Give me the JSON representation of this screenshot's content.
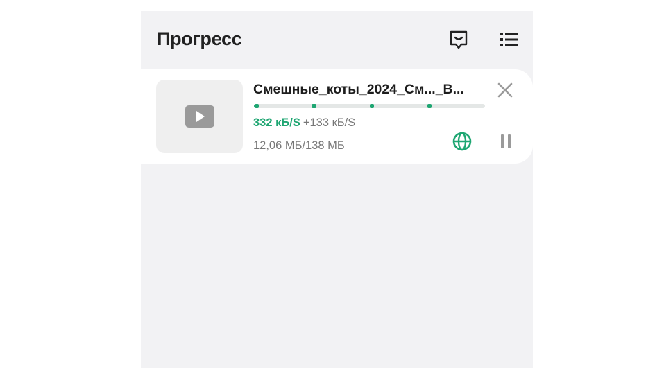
{
  "header": {
    "title": "Прогресс",
    "feedback_icon": "chat-feedback-icon",
    "list_icon": "list-icon"
  },
  "download": {
    "thumbnail_icon": "video-play-icon",
    "file_name": "Смешные_коты_2024_См..._В...",
    "speed": "332 кБ/S",
    "extra_speed": "+133 кБ/S",
    "size": "12,06 МБ/138 МБ",
    "progress_segments": [
      {
        "start": 0.0,
        "end": 0.02
      },
      {
        "start": 0.25,
        "end": 0.27
      },
      {
        "start": 0.5,
        "end": 0.52
      },
      {
        "start": 0.75,
        "end": 0.77
      }
    ],
    "close_icon": "close-icon",
    "globe_icon": "globe-icon",
    "pause_icon": "pause-icon"
  },
  "colors": {
    "accent": "#1ea672",
    "background": "#f2f2f4",
    "card": "#ffffff",
    "muted_text": "#777777",
    "icon_gray": "#9a9a9a"
  }
}
